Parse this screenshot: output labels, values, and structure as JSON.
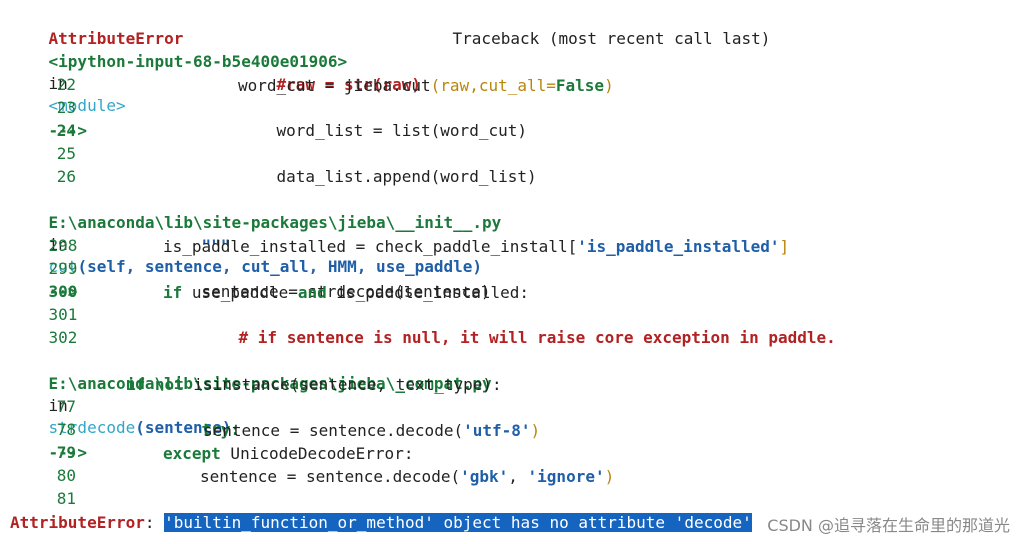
{
  "header": {
    "error_type": "AttributeError",
    "traceback_title": "Traceback (most recent call last)"
  },
  "frame1": {
    "source": "<ipython-input-68-b5e400e01906>",
    "in_word": "in",
    "scope": "<module>",
    "lines": [
      {
        "no": "22",
        "code": "#raw = str(raw)"
      },
      {
        "no": "23",
        "code_pre": "word_cut = jieba.cut",
        "code_args": "(raw,cut_all=",
        "code_kw": "False",
        "code_post": ")"
      },
      {
        "no": "24",
        "arrow": "--->",
        "code": "word_list = list(word_cut)"
      },
      {
        "no": "25",
        "code": ""
      },
      {
        "no": "26",
        "code": "data_list.append(word_list)"
      }
    ]
  },
  "frame2": {
    "path": "E:\\anaconda\\lib\\site-packages\\jieba\\__init__.py",
    "in_word": "in",
    "func": "cut",
    "sig": "(self, sentence, cut_all, HMM, use_paddle)",
    "lines": [
      {
        "no": "298",
        "code": "\"\"\""
      },
      {
        "no": "299",
        "code_pre": "is_paddle_installed = check_paddle_install[",
        "code_str": "'is_paddle_installed'",
        "code_post": "]"
      },
      {
        "no": "300",
        "arrow": "-->",
        "code": "sentence = strdecode(sentence)"
      },
      {
        "no": "301",
        "kw1": "if",
        "mid1": " use_paddle ",
        "kw2": "and",
        "mid2": " is_paddle_installed:"
      },
      {
        "no": "302",
        "comment": "# if sentence is null, it will raise core exception in paddle."
      }
    ]
  },
  "frame3": {
    "path": "E:\\anaconda\\lib\\site-packages\\jieba\\_compat.py",
    "in_word": "in",
    "func": "strdecode",
    "sig": "(sentence)",
    "lines": [
      {
        "no": "77",
        "kw1": "if not",
        "mid": " isinstance(sentence, text_type):"
      },
      {
        "no": "78",
        "kw": "try:"
      },
      {
        "no": "79",
        "arrow": "--->",
        "code_pre": "sentence = sentence.decode(",
        "code_str": "'utf-8'",
        "code_post": ")"
      },
      {
        "no": "80",
        "kw": "except",
        "mid": " UnicodeDecodeError:"
      },
      {
        "no": "81",
        "code_pre": "sentence = sentence.decode(",
        "code_str1": "'gbk'",
        "code_sep": ", ",
        "code_str2": "'ignore'",
        "code_post": ")"
      }
    ]
  },
  "footer": {
    "error_type": "AttributeError",
    "colon": ":",
    "message": "'builtin_function_or_method' object has no attribute 'decode'"
  },
  "watermark": "CSDN @追寻落在生命里的那道光"
}
